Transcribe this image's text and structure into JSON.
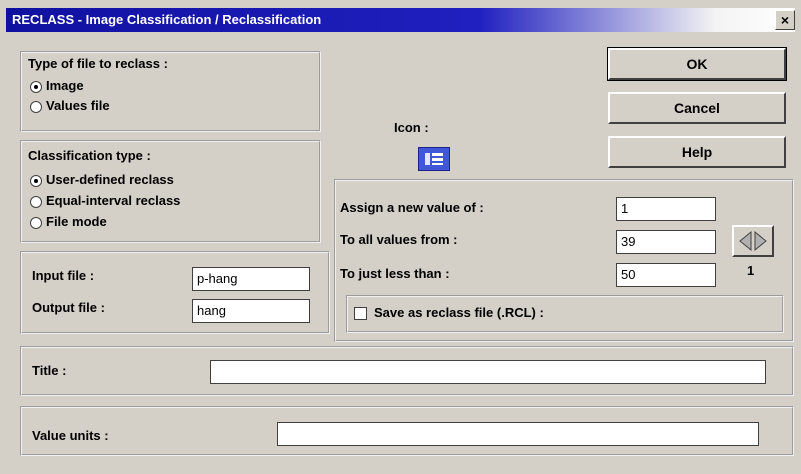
{
  "window": {
    "title": "RECLASS - Image Classification / Reclassification",
    "close": "×"
  },
  "file_type": {
    "heading": "Type of file to reclass :",
    "options": [
      {
        "label": "Image",
        "selected": true
      },
      {
        "label": "Values file",
        "selected": false
      }
    ]
  },
  "classification": {
    "heading": "Classification type :",
    "options": [
      {
        "label": "User-defined reclass",
        "selected": true
      },
      {
        "label": "Equal-interval reclass",
        "selected": false
      },
      {
        "label": "File mode",
        "selected": false
      }
    ]
  },
  "files": {
    "input_label": "Input file :",
    "input_value": "p-hang",
    "output_label": "Output file :",
    "output_value": "hang"
  },
  "icon": {
    "label": "Icon :",
    "name": "list-icon"
  },
  "buttons": {
    "ok": "OK",
    "cancel": "Cancel",
    "help": "Help"
  },
  "assign": {
    "new_value_label": "Assign a new value of :",
    "new_value": "1",
    "from_label": "To all values from :",
    "from_value": "39",
    "less_label": "To just less than :",
    "less_value": "50",
    "step": "1"
  },
  "save_rcl": {
    "label": "Save as reclass file (.RCL) :",
    "checked": false
  },
  "title_field": {
    "label": "Title :",
    "value": ""
  },
  "units_field": {
    "label": "Value units :",
    "value": ""
  }
}
